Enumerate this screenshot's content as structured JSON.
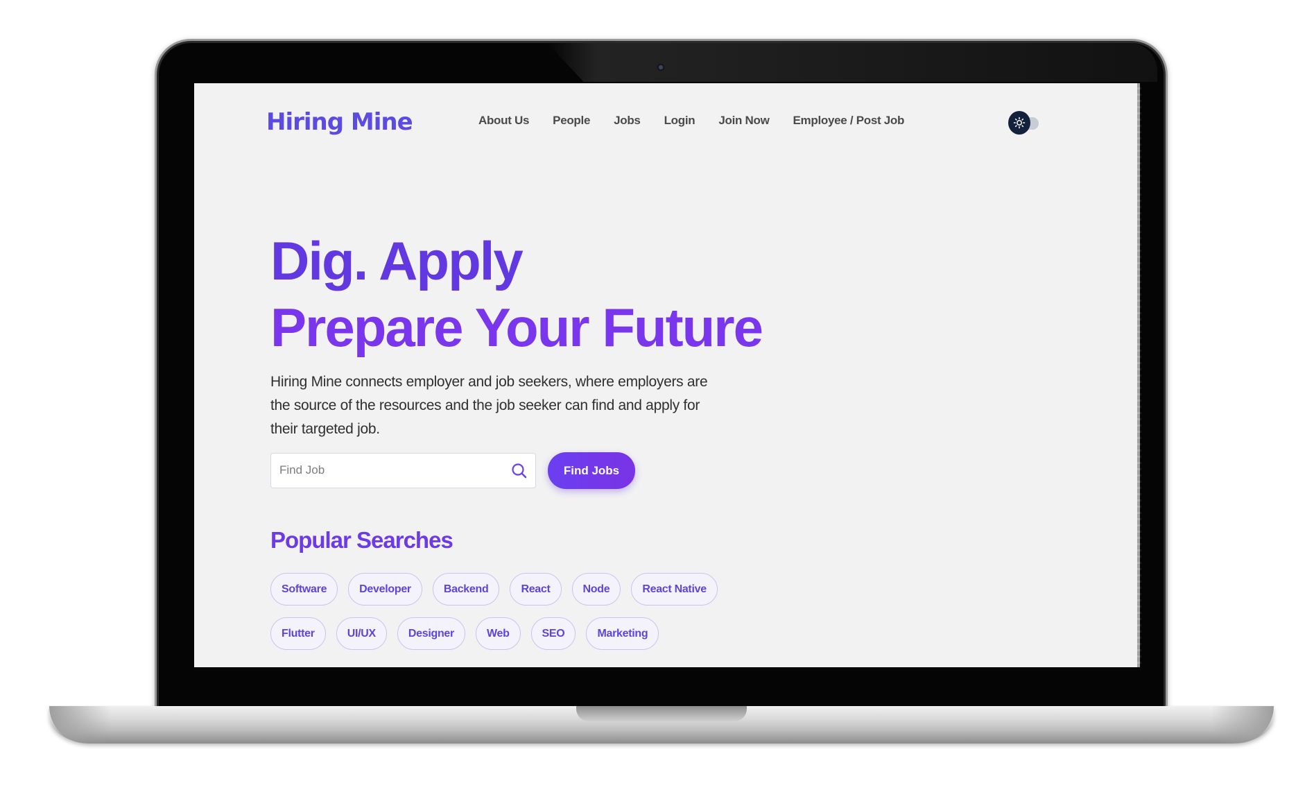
{
  "header": {
    "logo_text": "Hiring Mine",
    "nav": [
      "About Us",
      "People",
      "Jobs",
      "Login",
      "Join Now",
      "Employee / Post Job"
    ],
    "theme_toggle_icon": "sun-icon"
  },
  "hero": {
    "title_line1": "Dig. Apply",
    "title_line2": "Prepare Your Future",
    "description": "Hiring Mine connects employer and job seekers, where employers are the source of the resources and the job seeker can find and apply for their targeted job."
  },
  "search": {
    "placeholder": "Find Job",
    "value": "",
    "button_label": "Find Jobs"
  },
  "popular": {
    "title": "Popular Searches",
    "row1": [
      "Software",
      "Developer",
      "Backend",
      "React",
      "Node",
      "React Native"
    ],
    "row2": [
      "Flutter",
      "UI/UX",
      "Designer",
      "Web",
      "SEO",
      "Marketing"
    ]
  },
  "colors": {
    "brand": "#6238e0",
    "brand_secondary": "#7a36ec",
    "toggle_knob": "#14213d",
    "background": "#f2f2f2"
  }
}
